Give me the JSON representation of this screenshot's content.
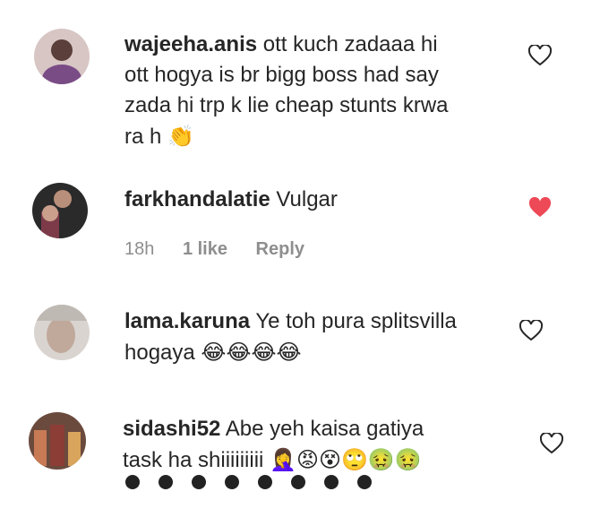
{
  "comments": [
    {
      "username": "wajeeha.anis",
      "text": "ott kuch zadaaa hi",
      "text2": "ott hogya is br bigg boss had say",
      "text3": "zada hi trp k lie cheap stunts krwa",
      "text4": "ra h",
      "emoji": "👏",
      "liked": false
    },
    {
      "username": "farkhandalatie",
      "text": "Vulgar",
      "time": "18h",
      "likes": "1 like",
      "reply": "Reply",
      "liked": true
    },
    {
      "username": "lama.karuna",
      "text": "Ye toh pura splitsvilla",
      "text2": "hogaya",
      "emoji": "😂😂😂😂",
      "liked": false
    },
    {
      "username": "sidashi52",
      "text": "Abe yeh kaisa gatiya",
      "text2": "task ha shiiiiiiiii",
      "emoji": "🤦‍♀️😡😵🙄🤢🤢",
      "liked": false
    }
  ],
  "colors": {
    "heart_liked": "#ed4956",
    "meta_gray": "#8e8e8e",
    "text": "#262626"
  }
}
